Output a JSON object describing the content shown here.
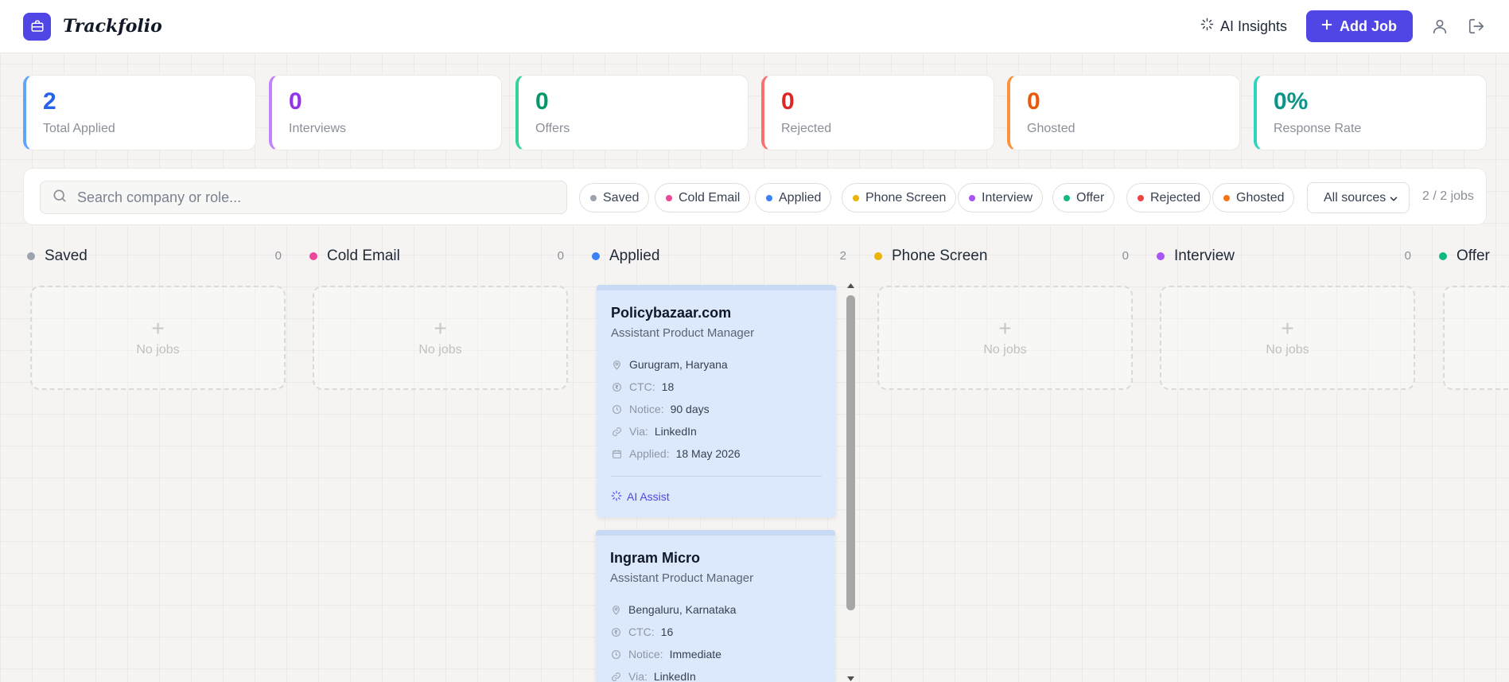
{
  "header": {
    "brand": "Trackfolio",
    "ai_insights_label": "AI Insights",
    "add_job_label": "Add Job"
  },
  "stats": [
    {
      "value": "2",
      "label": "Total Applied",
      "color": "#2563eb",
      "border": "#60a5fa"
    },
    {
      "value": "0",
      "label": "Interviews",
      "color": "#9333ea",
      "border": "#c084fc"
    },
    {
      "value": "0",
      "label": "Offers",
      "color": "#059669",
      "border": "#34d399"
    },
    {
      "value": "0",
      "label": "Rejected",
      "color": "#dc2626",
      "border": "#f87171"
    },
    {
      "value": "0",
      "label": "Ghosted",
      "color": "#ea580c",
      "border": "#fb923c"
    },
    {
      "value": "0%",
      "label": "Response Rate",
      "color": "#0d9488",
      "border": "#2dd4bf"
    }
  ],
  "filters": {
    "search_placeholder": "Search company or role...",
    "statuses": [
      {
        "label": "Saved",
        "color": "#9ca3af"
      },
      {
        "label": "Cold Email",
        "color": "#ec4899"
      },
      {
        "label": "Applied",
        "color": "#3b82f6"
      },
      {
        "label": "Phone Screen",
        "color": "#eab308"
      },
      {
        "label": "Interview",
        "color": "#a855f7"
      },
      {
        "label": "Offer",
        "color": "#10b981"
      },
      {
        "label": "Rejected",
        "color": "#ef4444"
      },
      {
        "label": "Ghosted",
        "color": "#f97316"
      }
    ],
    "source_select": "All sources",
    "job_count": "2 / 2 jobs"
  },
  "columns": [
    {
      "title": "Saved",
      "count": "0",
      "color": "#9ca3af",
      "empty_text": "No jobs"
    },
    {
      "title": "Cold Email",
      "count": "0",
      "color": "#ec4899",
      "empty_text": "No jobs"
    },
    {
      "title": "Applied",
      "count": "2",
      "color": "#3b82f6"
    },
    {
      "title": "Phone Screen",
      "count": "0",
      "color": "#eab308",
      "empty_text": "No jobs"
    },
    {
      "title": "Interview",
      "count": "0",
      "color": "#a855f7",
      "empty_text": "No jobs"
    },
    {
      "title": "Offer",
      "color": "#10b981"
    }
  ],
  "jobs": [
    {
      "company": "Policybazaar.com",
      "role": "Assistant Product Manager",
      "location": "Gurugram, Haryana",
      "ctc_label": "CTC:",
      "ctc": "18",
      "notice_label": "Notice:",
      "notice": "90 days",
      "via_label": "Via:",
      "via": "LinkedIn",
      "applied_label": "Applied:",
      "applied": "18 May 2026",
      "ai_assist": "AI Assist"
    },
    {
      "company": "Ingram Micro",
      "role": "Assistant Product Manager",
      "location": "Bengaluru, Karnataka",
      "ctc_label": "CTC:",
      "ctc": "16",
      "notice_label": "Notice:",
      "notice": "Immediate",
      "via_label": "Via:",
      "via": "LinkedIn"
    }
  ],
  "icons": {
    "logo": "briefcase-icon",
    "ai": "sparkle-icon",
    "add": "plus-icon",
    "user": "user-icon",
    "logout": "logout-icon",
    "search": "search-icon",
    "location": "map-pin-icon",
    "ctc": "rupee-icon",
    "notice": "clock-icon",
    "via": "link-icon",
    "applied": "calendar-icon"
  }
}
